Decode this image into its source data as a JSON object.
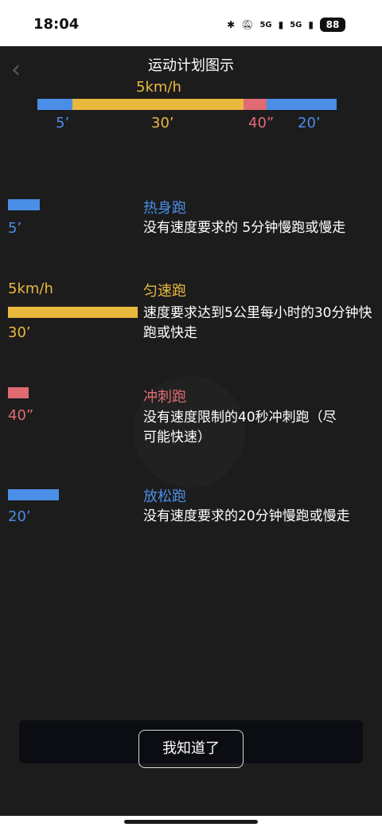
{
  "status_bar": {
    "time": "18:04",
    "signal1": "5G",
    "signal2": "5G",
    "battery": "88"
  },
  "header": {
    "title": "运动计划图示"
  },
  "plan": {
    "speed": "5km/h",
    "segments": [
      {
        "label": "5’",
        "color": "#4a8ee6"
      },
      {
        "label": "30’",
        "color": "#e9b93e"
      },
      {
        "label": "40”",
        "color": "#e06b73"
      },
      {
        "label": "20’",
        "color": "#4a8ee6"
      }
    ]
  },
  "sections": {
    "warmup": {
      "title": "热身跑",
      "duration": "5’",
      "desc": "没有速度要求的 5分钟慢跑或慢走"
    },
    "steady": {
      "title": "匀速跑",
      "duration": "30’",
      "speed": "5km/h",
      "desc": "速度要求达到5公里每小时的30分钟快跑或快走"
    },
    "sprint": {
      "title": "冲刺跑",
      "duration": "40”",
      "desc": "没有速度限制的40秒冲刺跑（尽可能快速）"
    },
    "cooldown": {
      "title": "放松跑",
      "duration": "20’",
      "desc": "没有速度要求的20分钟慢跑或慢走"
    }
  },
  "ok_button": {
    "label": "我知道了"
  },
  "colors": {
    "blue": "#4a8ee6",
    "yellow": "#e9b93e",
    "red": "#e06b73"
  }
}
